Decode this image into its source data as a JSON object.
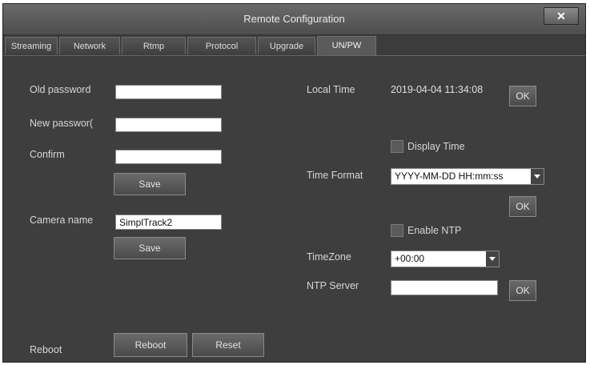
{
  "window": {
    "title": "Remote Configuration",
    "close_label": "✕"
  },
  "tabs": [
    {
      "label": "Streaming"
    },
    {
      "label": "Network"
    },
    {
      "label": "Rtmp"
    },
    {
      "label": "Protocol"
    },
    {
      "label": "Upgrade"
    },
    {
      "label": "UN/PW"
    }
  ],
  "active_tab": "UN/PW",
  "password": {
    "old_label": "Old password",
    "old_value": "",
    "new_label": "New passwor(",
    "new_value": "",
    "confirm_label": "Confirm",
    "confirm_value": "",
    "save_label": "Save"
  },
  "camera": {
    "name_label": "Camera name",
    "name_value": "SimplTrack2",
    "save_label": "Save"
  },
  "reboot": {
    "label": "Reboot",
    "reboot_button": "Reboot",
    "reset_button": "Reset"
  },
  "time": {
    "local_time_label": "Local Time",
    "local_time_value": "2019-04-04 11:34:08",
    "ok_label": "OK",
    "display_time_label": "Display Time",
    "display_time_checked": false,
    "time_format_label": "Time Format",
    "time_format_value": "YYYY-MM-DD HH:mm:ss",
    "format_ok_label": "OK",
    "enable_ntp_label": "Enable NTP",
    "enable_ntp_checked": false,
    "timezone_label": "TimeZone",
    "timezone_value": "+00:00",
    "ntp_server_label": "NTP Server",
    "ntp_server_value": "",
    "ntp_ok_label": "OK"
  },
  "colors": {
    "panel": "#3e3e3e",
    "titlebar": "#5a5a5a",
    "text": "#d6d6d6"
  }
}
